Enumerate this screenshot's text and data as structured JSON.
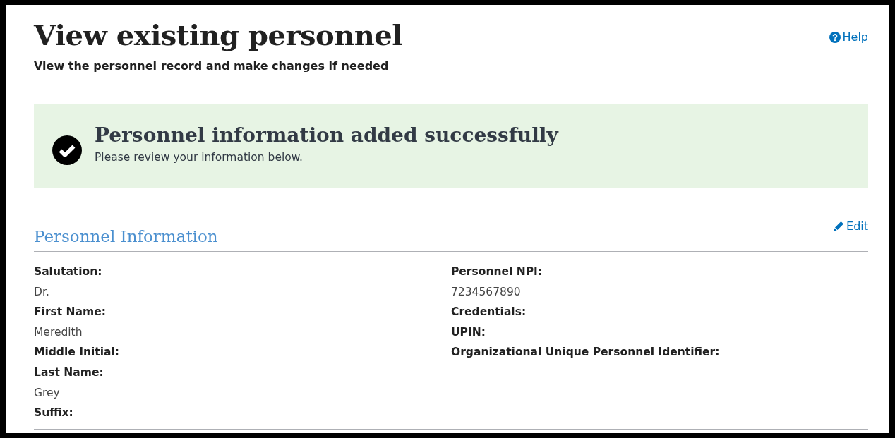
{
  "page": {
    "title": "View existing personnel",
    "subtitle": "View the personnel record and make changes if needed",
    "help_link": "Help"
  },
  "alert": {
    "kind": "success",
    "title": "Personnel information added successfully",
    "message": "Please review your information below."
  },
  "section": {
    "title": "Personnel Information",
    "edit_link": "Edit",
    "columns": [
      [
        {
          "label": "Salutation:",
          "value": "Dr."
        },
        {
          "label": "First Name:",
          "value": "Meredith"
        },
        {
          "label": "Middle Initial:"
        },
        {
          "label": "Last Name:",
          "value": "Grey"
        },
        {
          "label": "Suffix:"
        }
      ],
      [
        {
          "label": "Personnel NPI:",
          "value": "7234567890"
        },
        {
          "label": "Credentials:"
        },
        {
          "label": "UPIN:"
        },
        {
          "label": "Organizational Unique Personnel Identifier:"
        }
      ]
    ]
  }
}
